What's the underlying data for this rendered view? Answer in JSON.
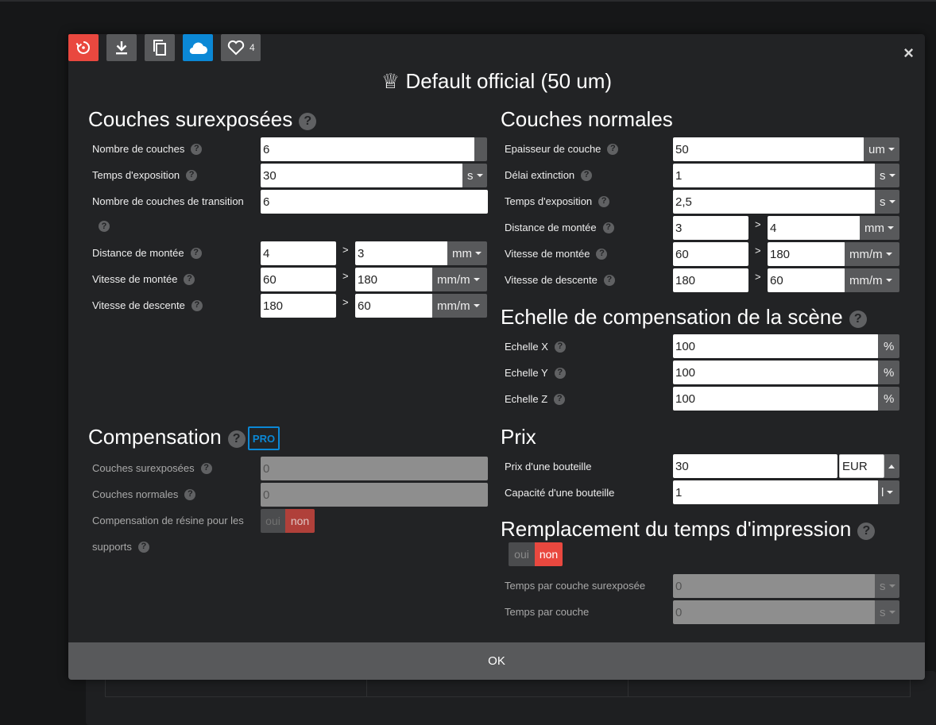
{
  "modal": {
    "title": "♕ Default official (50 um)",
    "close": "×",
    "likes": "4",
    "ok": "OK"
  },
  "overexposed": {
    "heading": "Couches surexposées",
    "layers_label": "Nombre de couches",
    "layers_value": "6",
    "exposure_label": "Temps d'exposition",
    "exposure_value": "30",
    "exposure_unit": "s",
    "transition_label": "Nombre de couches de transition",
    "transition_value": "6",
    "lift_dist_label": "Distance de montée",
    "lift_dist_a": "4",
    "lift_dist_b": "3",
    "lift_dist_unit": "mm",
    "lift_speed_label": "Vitesse de montée",
    "lift_speed_a": "60",
    "lift_speed_b": "180",
    "lift_speed_unit": "mm/m",
    "retract_label": "Vitesse de descente",
    "retract_a": "180",
    "retract_b": "60",
    "retract_unit": "mm/m"
  },
  "normal": {
    "heading": "Couches normales",
    "thickness_label": "Epaisseur de couche",
    "thickness_value": "50",
    "thickness_unit": "um",
    "off_delay_label": "Délai extinction",
    "off_delay_value": "1",
    "off_delay_unit": "s",
    "exposure_label": "Temps d'exposition",
    "exposure_value": "2,5",
    "exposure_unit": "s",
    "lift_dist_label": "Distance de montée",
    "lift_dist_a": "3",
    "lift_dist_b": "4",
    "lift_dist_unit": "mm",
    "lift_speed_label": "Vitesse de montée",
    "lift_speed_a": "60",
    "lift_speed_b": "180",
    "lift_speed_unit": "mm/m",
    "retract_label": "Vitesse de descente",
    "retract_a": "180",
    "retract_b": "60",
    "retract_unit": "mm/m"
  },
  "scale": {
    "heading": "Echelle de compensation de la scène",
    "x_label": "Echelle X",
    "x_value": "100",
    "y_label": "Echelle Y",
    "y_value": "100",
    "z_label": "Echelle Z",
    "z_value": "100",
    "unit": "%"
  },
  "compensation": {
    "heading": "Compensation",
    "pro": "PRO",
    "over_label": "Couches surexposées",
    "over_value": "0",
    "normal_label": "Couches normales",
    "normal_value": "0",
    "resin_label_1": "Compensation de résine pour les",
    "resin_label_2": "supports",
    "oui": "oui",
    "non": "non"
  },
  "price": {
    "heading": "Prix",
    "bottle_price_label": "Prix d'une bouteille",
    "bottle_price_value": "30",
    "currency": "EUR",
    "bottle_capacity_label": "Capacité d'une bouteille",
    "bottle_capacity_value": "1",
    "capacity_unit": "l"
  },
  "override": {
    "heading": "Remplacement du temps d'impression",
    "oui": "oui",
    "non": "non",
    "over_time_label": "Temps par couche surexposée",
    "over_time_value": "0",
    "over_time_unit": "s",
    "layer_time_label": "Temps par couche",
    "layer_time_value": "0",
    "layer_time_unit": "s"
  },
  "gt": ">",
  "help": "?",
  "colors": {
    "accent_red": "#e9483f",
    "accent_blue": "#0b88d6",
    "panel": "#222325",
    "button": "#58595b"
  },
  "icons": [
    "reset-icon",
    "download-icon",
    "copy-icon",
    "cloud-icon",
    "heart-icon"
  ]
}
